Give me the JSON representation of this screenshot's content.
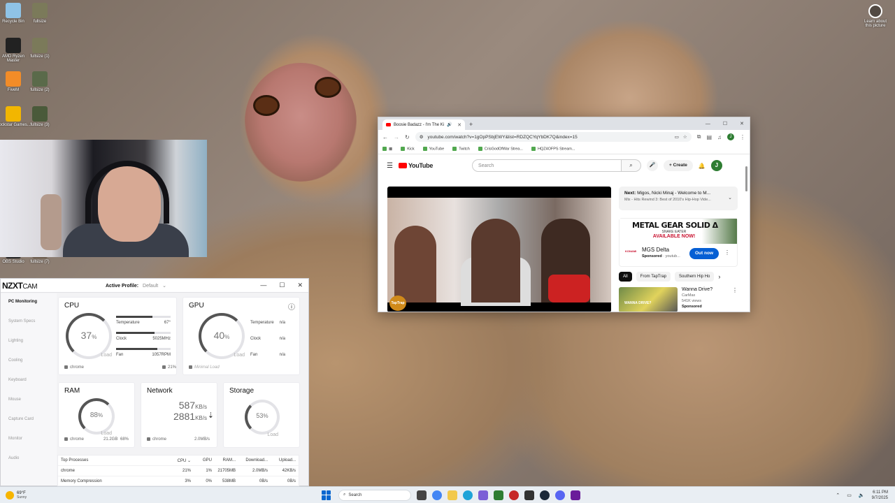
{
  "desktop": {
    "icons": [
      {
        "label": "Recycle Bin",
        "color": "#8fc3e6"
      },
      {
        "label": "fullsize",
        "color": "#7b7a5a"
      },
      {
        "label": "AMD Ryzen Master",
        "color": "#222222"
      },
      {
        "label": "fullsize (1)",
        "color": "#7b7a5a"
      },
      {
        "label": "FiveM",
        "color": "#f28c28"
      },
      {
        "label": "fullsize (2)",
        "color": "#5a6a4a"
      },
      {
        "label": "Rockstar Games...",
        "color": "#f2b600"
      },
      {
        "label": "fullsize (3)",
        "color": "#4a5a3a"
      },
      {
        "label": "OBS Studio",
        "color": "#222222"
      },
      {
        "label": "fullsize (7)",
        "color": "#6a5a4a"
      }
    ],
    "learn_about": "Learn about this picture"
  },
  "nzxt": {
    "logo": "NZXT",
    "logo_suffix": "CAM",
    "active_profile_label": "Active Profile:",
    "active_profile_value": "Default",
    "minimize": "—",
    "maximize": "☐",
    "close": "✕",
    "sidebar": [
      "PC Monitoring",
      "System Specs",
      "Lighting",
      "Cooling",
      "Keyboard",
      "Mouse",
      "Capture Card",
      "Monitor",
      "Audio"
    ],
    "cpu": {
      "title": "CPU",
      "value": "37",
      "unit": "%",
      "load_label": "Load",
      "temperature_label": "Temperature",
      "temperature_value": "67°",
      "clock_label": "Clock",
      "clock_value": "5025MHz",
      "fan_label": "Fan",
      "fan_value": "1057RPM",
      "temperature_fill": 0.67,
      "clock_fill": 0.7,
      "fan_fill": 0.75,
      "process": "chrome",
      "process_value": "21%"
    },
    "gpu": {
      "title": "GPU",
      "value": "40",
      "unit": "%",
      "load_label": "Load",
      "temperature_label": "Temperature",
      "temperature_value": "n/a",
      "clock_label": "Clock",
      "clock_value": "n/a",
      "fan_label": "Fan",
      "fan_value": "n/a",
      "process": "Minimal Load",
      "info_icon": "ⓘ"
    },
    "ram": {
      "title": "RAM",
      "value": "88",
      "unit": "%",
      "load_label": "Load",
      "process": "chrome",
      "process_value": "21.2GB",
      "process_pct": "68%"
    },
    "network": {
      "title": "Network",
      "down_value": "587",
      "down_unit": "KB/s",
      "up_value": "2881",
      "up_unit": "KB/s",
      "process": "chrome",
      "process_value": "2.0MB/s"
    },
    "storage": {
      "title": "Storage",
      "value": "53",
      "unit": "%",
      "load_label": "Load"
    },
    "table": {
      "headers": [
        "Top Processes",
        "CPU ⌄",
        "GPU",
        "RAM...",
        "Download...",
        "Upload..."
      ],
      "rows": [
        [
          "chrome",
          "21%",
          "1%",
          "21705MB",
          "2.0MB/s",
          "42KB/s"
        ],
        [
          "Memory Compression",
          "3%",
          "0%",
          "538MB",
          "0B/s",
          "0B/s"
        ]
      ]
    }
  },
  "chrome": {
    "tab_title": "Boosie Badazz - I'm The Ki",
    "tab_audio": "🔊",
    "tab_close": "✕",
    "new_tab": "+",
    "win_min": "—",
    "win_max": "☐",
    "win_close": "✕",
    "url": "youtube.com/watch?v=1gOpPSbjEWY&list=RDZQCYqYbDK7Q&index=15",
    "profile": "J",
    "bookmarks": [
      "Kick",
      "YouTube",
      "Twitch",
      "CrisGodOfWar Strea...",
      "HQZ4OFPS Stream..."
    ],
    "youtube": {
      "brand": "YouTube",
      "search_placeholder": "Search",
      "create": "+ Create",
      "avatar": "J",
      "next_label": "Next:",
      "next_title": "Migos, Nicki Minaj - Welcome to M...",
      "next_sub": "Mix - Hits Rewind 3: Best of 2010's Hip-Hop Vide...",
      "ad_title_line1": "METAL GEAR SOLID Δ",
      "ad_title_line2": "SNAKE EATER",
      "ad_title_line3": "AVAILABLE NOW!",
      "ad_brand": "KONAMI",
      "ad_name": "MGS Delta",
      "ad_sponsored": "Sponsored",
      "ad_domain": "· youtub...",
      "ad_button": "Out now",
      "chips": [
        "All",
        "From TapTrap",
        "Southern Hip Ho"
      ],
      "video_tag": "TapTrap",
      "rec_thumb_text": "WANNA DRIVE?",
      "rec_title": "Wanna Drive?",
      "rec_channel": "CarMax",
      "rec_views": "541K views",
      "rec_sponsored": "Sponsored"
    }
  },
  "taskbar": {
    "temperature": "69°F",
    "condition": "Sunny",
    "search": "Search",
    "time": "6:11 PM",
    "date": "9/7/2025"
  }
}
